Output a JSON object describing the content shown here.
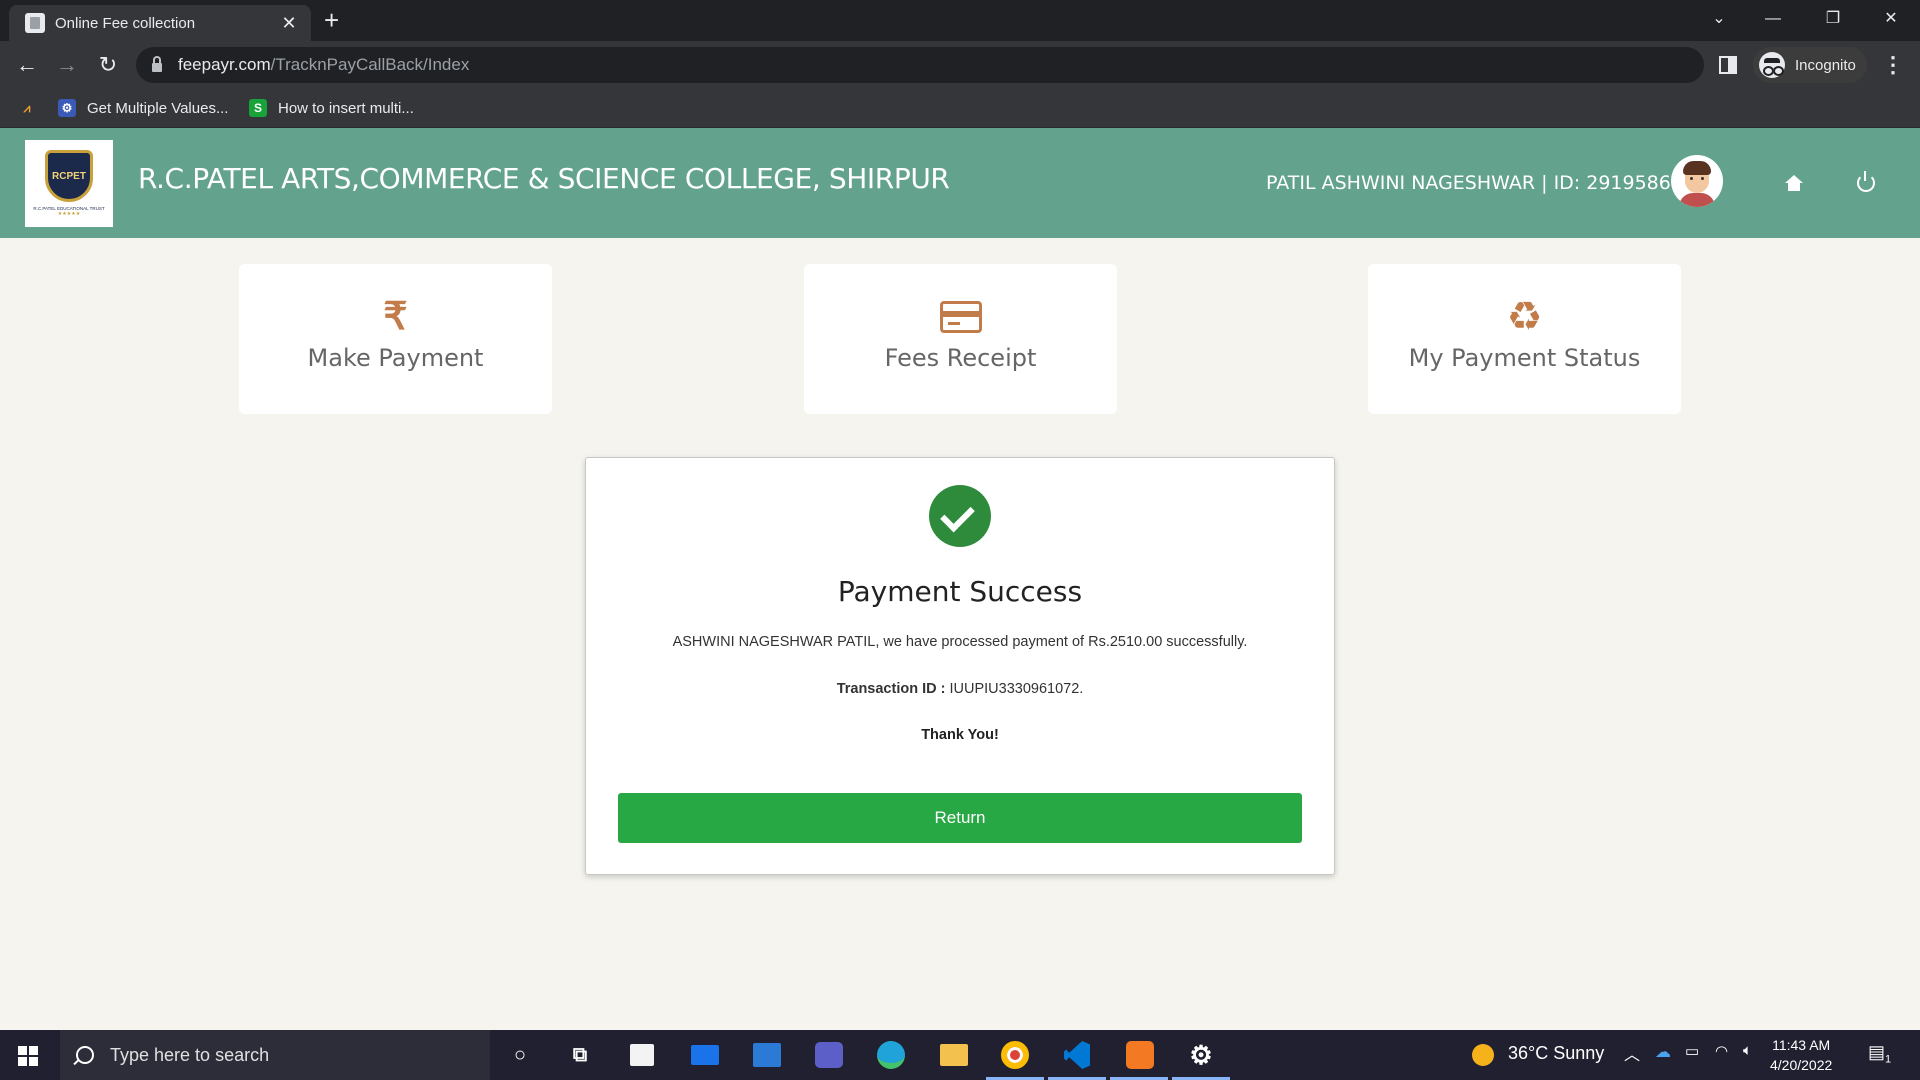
{
  "browser": {
    "tab_title": "Online Fee collection",
    "url_host": "feepayr.com",
    "url_path": "/TracknPayCallBack/Index",
    "profile_label": "Incognito",
    "bookmarks": [
      {
        "label": "Get Multiple Values..."
      },
      {
        "label": "How to insert multi..."
      }
    ]
  },
  "header": {
    "college_name": "R.C.PATEL ARTS,COMMERCE & SCIENCE COLLEGE, SHIRPUR",
    "user_info": "PATIL ASHWINI NAGESHWAR | ID: 2919586",
    "logo_text": "RCPET",
    "logo_subtext": "R.C.PATEL EDUCATIONAL TRUST",
    "bg_color": "#63a38e"
  },
  "cards": [
    {
      "label": "Make Payment",
      "icon": "rupee-icon"
    },
    {
      "label": "Fees Receipt",
      "icon": "credit-card-icon"
    },
    {
      "label": "My Payment Status",
      "icon": "recycle-icon"
    }
  ],
  "result": {
    "title": "Payment Success",
    "message": "ASHWINI NAGESHWAR PATIL, we have processed payment of Rs.2510.00 successfully.",
    "transaction_label": "Transaction ID :",
    "transaction_id": " IUUPIU3330961072.",
    "thanks": "Thank You!",
    "return_label": "Return",
    "accent_color": "#28a745"
  },
  "taskbar": {
    "search_placeholder": "Type here to search",
    "weather": "36°C  Sunny",
    "time": "11:43 AM",
    "date": "4/20/2022",
    "notification_count": "1"
  }
}
